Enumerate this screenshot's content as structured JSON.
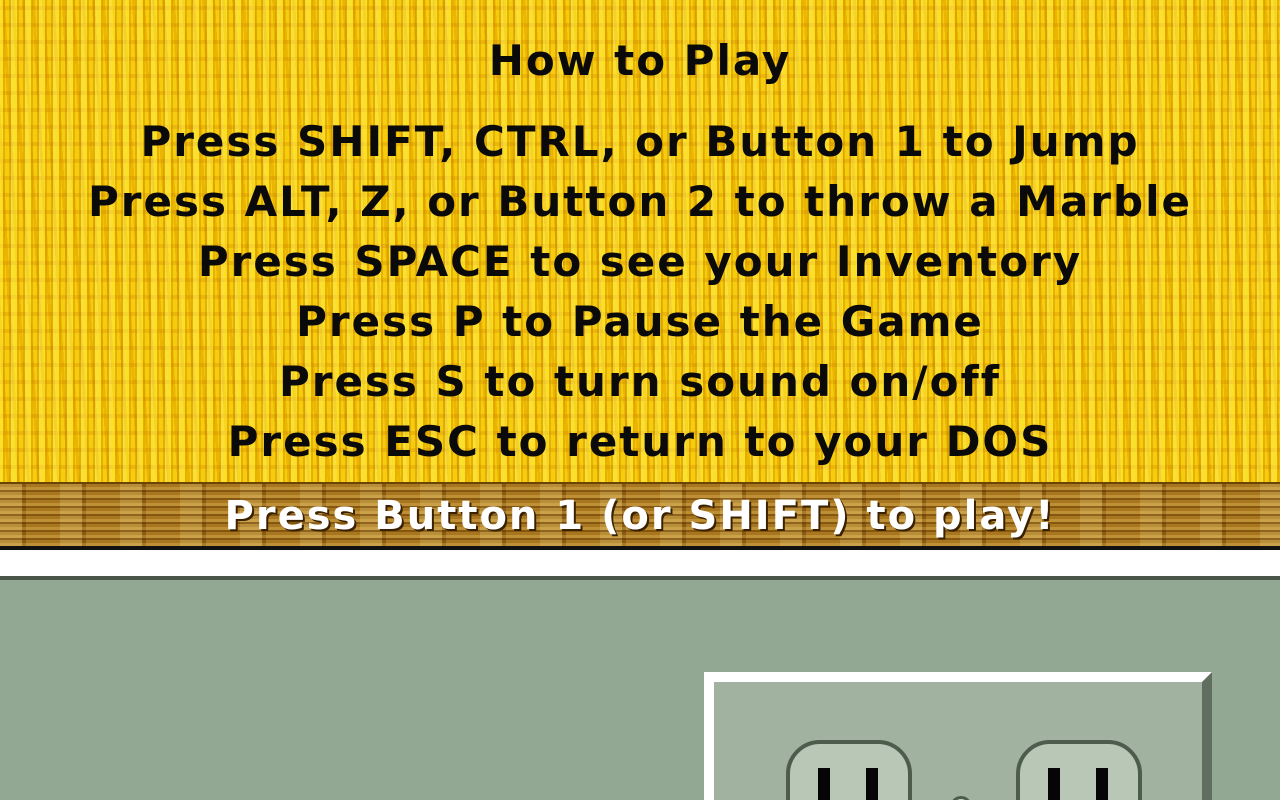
{
  "help": {
    "title": "How to Play",
    "lines": [
      "Press SHIFT, CTRL, or Button 1 to Jump",
      "Press ALT, Z, or Button 2 to throw a Marble",
      "Press SPACE to see your Inventory",
      "Press P to Pause the Game",
      "Press S to turn sound on/off",
      "Press ESC to return to your DOS"
    ]
  },
  "prompt": {
    "text": "Press Button 1 (or SHIFT) to play!"
  },
  "colors": {
    "panel_yellow": "#f2c200",
    "wood": "#a2701a",
    "wall_green": "#93a893",
    "text_dark": "#0a0a0a",
    "prompt_white": "#ffffff"
  },
  "icons": {
    "outlet": "electrical-outlet-icon"
  }
}
